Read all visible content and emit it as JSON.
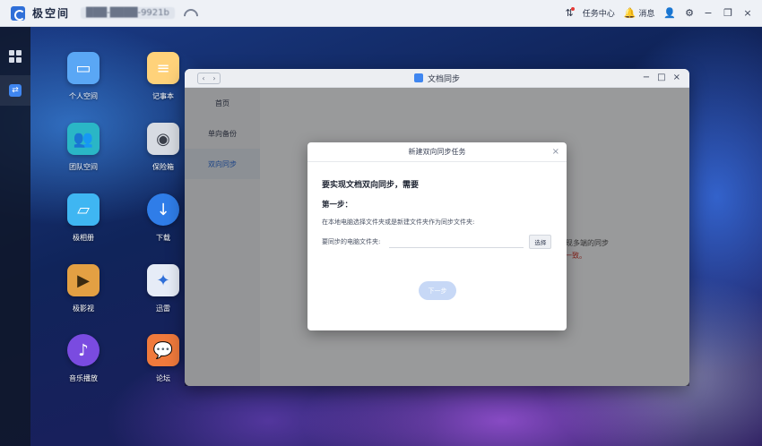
{
  "topbar": {
    "brand": "极空间",
    "device_id": "███-████-9921b",
    "tasks_label": "任务中心",
    "messages_label": "消息"
  },
  "desktop": {
    "icons": [
      {
        "label": "个人空间",
        "icon": "folder-icon",
        "color": "#5aa7f5"
      },
      {
        "label": "记事本",
        "icon": "notepad-icon",
        "color": "#ffd27a"
      },
      {
        "label": "团队空间",
        "icon": "team-folder-icon",
        "color": "#2ab6c6"
      },
      {
        "label": "保险箱",
        "icon": "safe-icon",
        "color": "#d7dbe2"
      },
      {
        "label": "极相册",
        "icon": "photo-album-icon",
        "color": "#3fb6f2"
      },
      {
        "label": "下载",
        "icon": "download-globe-icon",
        "color": "#2f7de8"
      },
      {
        "label": "极影视",
        "icon": "video-icon",
        "color": "#e3a043"
      },
      {
        "label": "迅雷",
        "icon": "xunlei-bird-icon",
        "color": "#e6ecf7"
      },
      {
        "label": "音乐播放",
        "icon": "music-note-icon",
        "color": "#7a4be0"
      },
      {
        "label": "论坛",
        "icon": "forum-chat-icon",
        "color": "#f07a3c"
      }
    ]
  },
  "window": {
    "title": "文档同步",
    "sidebar": [
      "首页",
      "单向备份",
      "双向同步"
    ],
    "active_index": 2,
    "bg_hint_1": "实现多端的同步",
    "bg_hint_2": "一致。"
  },
  "dialog": {
    "title": "新建双向同步任务",
    "heading": "要实现文档双向同步，需要",
    "step": "第一步：",
    "description": "在本地电脑选择文件夹或是新建文件夹作为同步文件夹:",
    "folder_label": "要同步的电脑文件夹:",
    "folder_value": "",
    "choose_label": "选择",
    "next_label": "下一步"
  }
}
